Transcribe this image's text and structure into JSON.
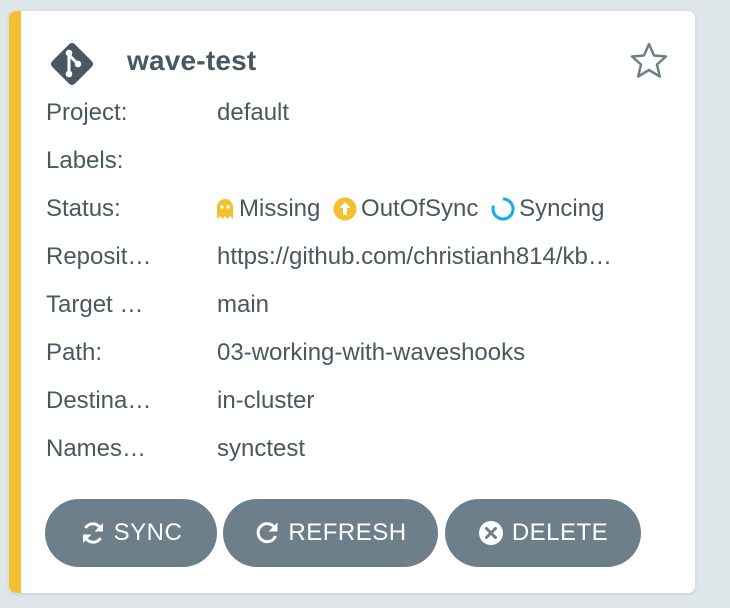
{
  "app": {
    "name": "wave-test",
    "accent_color": "#f4c030",
    "icon": "git-icon",
    "favorite_icon": "star-outline-icon"
  },
  "fields": [
    {
      "label": "Project:",
      "value": "default"
    },
    {
      "label": "Labels:",
      "value": ""
    },
    {
      "label": "Status:",
      "value": ""
    },
    {
      "label": "Reposit…",
      "value": "https://github.com/christianh814/kb…"
    },
    {
      "label": "Target …",
      "value": "main"
    },
    {
      "label": "Path:",
      "value": "03-working-with-waveshooks"
    },
    {
      "label": "Destina…",
      "value": "in-cluster"
    },
    {
      "label": "Names…",
      "value": "synctest"
    }
  ],
  "status": {
    "health": {
      "text": "Missing",
      "icon": "ghost-icon",
      "color": "#f4c030"
    },
    "sync": {
      "text": "OutOfSync",
      "icon": "arrow-up-circle-icon",
      "color": "#f4c030"
    },
    "operation": {
      "text": "Syncing",
      "icon": "spinner-icon",
      "color": "#0dadea"
    }
  },
  "buttons": {
    "sync": {
      "label": "SYNC",
      "icon": "sync-icon"
    },
    "refresh": {
      "label": "REFRESH",
      "icon": "redo-icon"
    },
    "delete": {
      "label": "DELETE",
      "icon": "times-circle-icon"
    },
    "color": "#6d7f8b"
  }
}
